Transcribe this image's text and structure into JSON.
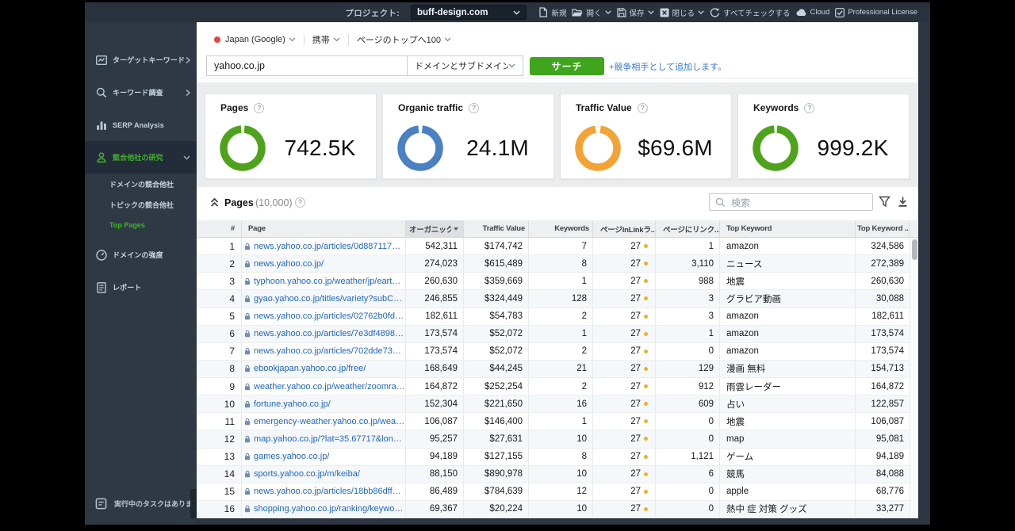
{
  "topbar": {
    "project": {
      "label": "プロジェクト:",
      "value": "buff-design.com"
    },
    "menu": [
      {
        "label": "新規",
        "icon": "new-document-icon",
        "chevron": false
      },
      {
        "label": "開く",
        "icon": "open-folder-icon",
        "chevron": true
      },
      {
        "label": "保存",
        "icon": "save-icon",
        "chevron": true
      },
      {
        "label": "閉じる",
        "icon": "close-project-icon",
        "chevron": true
      },
      {
        "label": "すべてチェックする",
        "icon": "refresh-icon",
        "chevron": false
      },
      {
        "label": "Cloud",
        "icon": "cloud-icon",
        "chevron": false
      },
      {
        "label": "Professional License",
        "icon": "license-icon",
        "chevron": false
      }
    ]
  },
  "sidebar": {
    "items": [
      {
        "label": "ターゲットキーワード",
        "icon": "target-keywords-icon",
        "chevron": "right",
        "selected": false
      },
      {
        "label": "キーワード調査",
        "icon": "keyword-research-icon",
        "chevron": "right",
        "selected": false
      },
      {
        "label": "SERP Analysis",
        "icon": "serp-analysis-icon",
        "selected": false
      },
      {
        "label": "競合他社の研究",
        "icon": "competitor-research-icon",
        "chevron": "down",
        "selected": true
      },
      {
        "label": "ドメインの競合他社",
        "type": "sub",
        "selected": false
      },
      {
        "label": "トピックの競合他社",
        "type": "sub",
        "selected": false
      },
      {
        "label": "Top Pages",
        "type": "sub",
        "selected": true
      },
      {
        "label": "ドメインの強度",
        "icon": "domain-strength-icon",
        "selected": false
      },
      {
        "label": "レポート",
        "icon": "reports-icon",
        "selected": false
      }
    ],
    "footer": {
      "label": "実行中のタスクはありま…"
    }
  },
  "filters": {
    "search_engine": "Japan (Google)",
    "device": "携帯",
    "depth": "ページのトップへ100"
  },
  "search": {
    "query": "yahoo.co.jp",
    "scope": "ドメインとサブドメイン",
    "button_label": "サーチ",
    "add_competitor_link": "+競争相手として追加します。"
  },
  "cards": [
    {
      "title": "Pages",
      "value": "742.5K",
      "ring_color": "#4fa31c",
      "ring_fraction": 0.972,
      "help_glyph": "?"
    },
    {
      "title": "Organic traffic",
      "value": "24.1M",
      "ring_color": "#4b80c3",
      "ring_fraction": 0.968,
      "help_glyph": "?"
    },
    {
      "title": "Traffic Value",
      "value": "$69.6M",
      "ring_color": "#f1a435",
      "ring_fraction": 0.958,
      "help_glyph": "?"
    },
    {
      "title": "Keywords",
      "value": "999.2K",
      "ring_color": "#4fa31c",
      "ring_fraction": 0.975,
      "help_glyph": "?"
    }
  ],
  "section": {
    "title": "Pages",
    "count": "(10,000)",
    "search_placeholder": "検索",
    "help_glyph": "?"
  },
  "table": {
    "columns": [
      "#",
      "Page",
      "オーガニック...",
      "Traffic Value",
      "Keywords",
      "ページInLinkラ...",
      "ページにリンク...",
      "Top Keyword",
      "Top Keyword ..."
    ],
    "sorted_column_index": 2,
    "rows": [
      {
        "num": "1",
        "page": "news.yahoo.co.jp/articles/0d8871176e...",
        "organic": "542,311",
        "traffic_value": "$174,742",
        "keywords": "7",
        "inlink_rank": "27",
        "linking_pages": "1",
        "top_keyword": "amazon",
        "top_keyword_traffic": "324,586"
      },
      {
        "num": "2",
        "page": "news.yahoo.co.jp/",
        "organic": "274,023",
        "traffic_value": "$615,489",
        "keywords": "8",
        "inlink_rank": "27",
        "linking_pages": "3,110",
        "top_keyword": "ニュース",
        "top_keyword_traffic": "272,389"
      },
      {
        "num": "3",
        "page": "typhoon.yahoo.co.jp/weather/jp/earthq...",
        "organic": "260,630",
        "traffic_value": "$359,669",
        "keywords": "1",
        "inlink_rank": "27",
        "linking_pages": "988",
        "top_keyword": "地震",
        "top_keyword_traffic": "260,630"
      },
      {
        "num": "4",
        "page": "gyao.yahoo.co.jp/titles/variety?subCateg...",
        "organic": "246,855",
        "traffic_value": "$324,449",
        "keywords": "128",
        "inlink_rank": "27",
        "linking_pages": "3",
        "top_keyword": "グラビア動画",
        "top_keyword_traffic": "30,088"
      },
      {
        "num": "5",
        "page": "news.yahoo.co.jp/articles/02762b0fd7a...",
        "organic": "182,611",
        "traffic_value": "$54,783",
        "keywords": "2",
        "inlink_rank": "27",
        "linking_pages": "3",
        "top_keyword": "amazon",
        "top_keyword_traffic": "182,611"
      },
      {
        "num": "6",
        "page": "news.yahoo.co.jp/articles/7e3df489853...",
        "organic": "173,574",
        "traffic_value": "$52,072",
        "keywords": "1",
        "inlink_rank": "27",
        "linking_pages": "1",
        "top_keyword": "amazon",
        "top_keyword_traffic": "173,574"
      },
      {
        "num": "7",
        "page": "news.yahoo.co.jp/articles/702dde730d...",
        "organic": "173,574",
        "traffic_value": "$52,072",
        "keywords": "2",
        "inlink_rank": "27",
        "linking_pages": "0",
        "top_keyword": "amazon",
        "top_keyword_traffic": "173,574"
      },
      {
        "num": "8",
        "page": "ebookjapan.yahoo.co.jp/free/",
        "organic": "168,649",
        "traffic_value": "$44,245",
        "keywords": "21",
        "inlink_rank": "27",
        "linking_pages": "129",
        "top_keyword": "漫画 無料",
        "top_keyword_traffic": "154,713"
      },
      {
        "num": "9",
        "page": "weather.yahoo.co.jp/weather/zoomradar/",
        "organic": "164,872",
        "traffic_value": "$252,254",
        "keywords": "2",
        "inlink_rank": "27",
        "linking_pages": "912",
        "top_keyword": "雨雲レーダー",
        "top_keyword_traffic": "164,872"
      },
      {
        "num": "10",
        "page": "fortune.yahoo.co.jp/",
        "organic": "152,304",
        "traffic_value": "$221,650",
        "keywords": "16",
        "inlink_rank": "27",
        "linking_pages": "609",
        "top_keyword": "占い",
        "top_keyword_traffic": "122,857"
      },
      {
        "num": "11",
        "page": "emergency-weather.yahoo.co.jp/weathe...",
        "organic": "106,087",
        "traffic_value": "$146,400",
        "keywords": "1",
        "inlink_rank": "27",
        "linking_pages": "0",
        "top_keyword": "地震",
        "top_keyword_traffic": "106,087"
      },
      {
        "num": "12",
        "page": "map.yahoo.co.jp/?lat=35.67717&lon=1...",
        "organic": "95,257",
        "traffic_value": "$27,631",
        "keywords": "10",
        "inlink_rank": "27",
        "linking_pages": "0",
        "top_keyword": "map",
        "top_keyword_traffic": "95,081"
      },
      {
        "num": "13",
        "page": "games.yahoo.co.jp/",
        "organic": "94,189",
        "traffic_value": "$127,155",
        "keywords": "8",
        "inlink_rank": "27",
        "linking_pages": "1,121",
        "top_keyword": "ゲーム",
        "top_keyword_traffic": "94,189"
      },
      {
        "num": "14",
        "page": "sports.yahoo.co.jp/m/keiba/",
        "organic": "88,150",
        "traffic_value": "$890,978",
        "keywords": "10",
        "inlink_rank": "27",
        "linking_pages": "6",
        "top_keyword": "競馬",
        "top_keyword_traffic": "84,088"
      },
      {
        "num": "15",
        "page": "news.yahoo.co.jp/articles/18bb86dff73...",
        "organic": "86,489",
        "traffic_value": "$784,639",
        "keywords": "12",
        "inlink_rank": "27",
        "linking_pages": "0",
        "top_keyword": "apple",
        "top_keyword_traffic": "68,776"
      },
      {
        "num": "16",
        "page": "shopping.yahoo.co.jp/ranking/keyword/...",
        "organic": "69,367",
        "traffic_value": "$20,224",
        "keywords": "10",
        "inlink_rank": "27",
        "linking_pages": "0",
        "top_keyword": "熱中 症 対策 グッズ",
        "top_keyword_traffic": "33,277"
      }
    ]
  },
  "colors": {
    "accent_green": "#41b32d",
    "button_green": "#3fa51d",
    "link_blue": "#3a7ad1",
    "table_link_blue": "#2065c0",
    "dot_amber": "#edb02e",
    "donut_green": "#4fa31c",
    "donut_blue": "#4b80c3",
    "donut_orange": "#f1a435"
  }
}
